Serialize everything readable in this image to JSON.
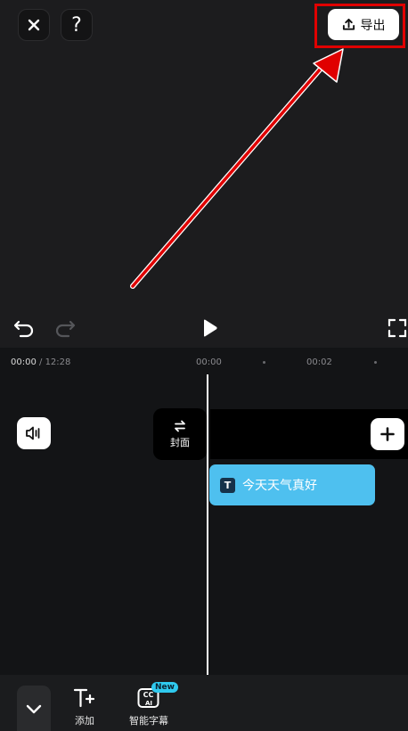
{
  "header": {
    "close_icon": "close-icon",
    "help_label": "?",
    "export_label": "导出",
    "export_icon": "upload-icon"
  },
  "annotation": {
    "highlight_color": "#e00000",
    "arrow_color": "#e00000"
  },
  "player": {
    "undo_icon": "undo-icon",
    "redo_icon": "redo-icon",
    "play_icon": "play-icon",
    "fullscreen_icon": "fullscreen-icon"
  },
  "timeline": {
    "current_time": "00:00",
    "separator": " / ",
    "total_time": "12:28",
    "ruler_labels": [
      "00:00",
      "00:02"
    ],
    "cover_label": "封面",
    "text_clip_label": "今天天气真好",
    "text_clip_color": "#4ec0ef"
  },
  "toolbar": {
    "tools": [
      {
        "label": "添加",
        "icon": "text-add-icon"
      },
      {
        "label": "智能字幕",
        "icon": "cc-ai-icon",
        "badge": "New"
      }
    ],
    "cc_text": "CC",
    "ai_text": "AI"
  }
}
